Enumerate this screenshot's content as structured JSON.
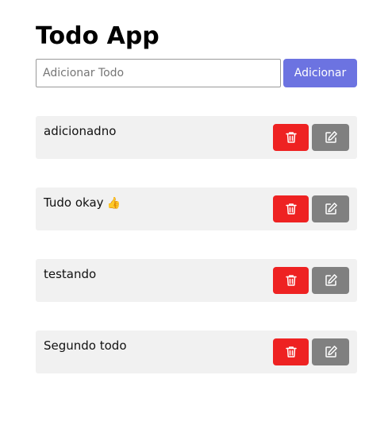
{
  "app": {
    "title": "Todo App"
  },
  "add_form": {
    "placeholder": "Adicionar Todo",
    "value": "",
    "button_label": "Adicionar"
  },
  "todos": [
    {
      "text": "adicionadno",
      "emoji": ""
    },
    {
      "text": "Tudo okay",
      "emoji": "👍"
    },
    {
      "text": "testando",
      "emoji": ""
    },
    {
      "text": "Segundo todo",
      "emoji": ""
    }
  ],
  "icons": {
    "delete": "trash-icon",
    "edit": "edit-icon"
  },
  "colors": {
    "accent": "#6c73e1",
    "delete": "#ee2222",
    "edit": "#808080",
    "item_bg": "#f1f1f1"
  }
}
